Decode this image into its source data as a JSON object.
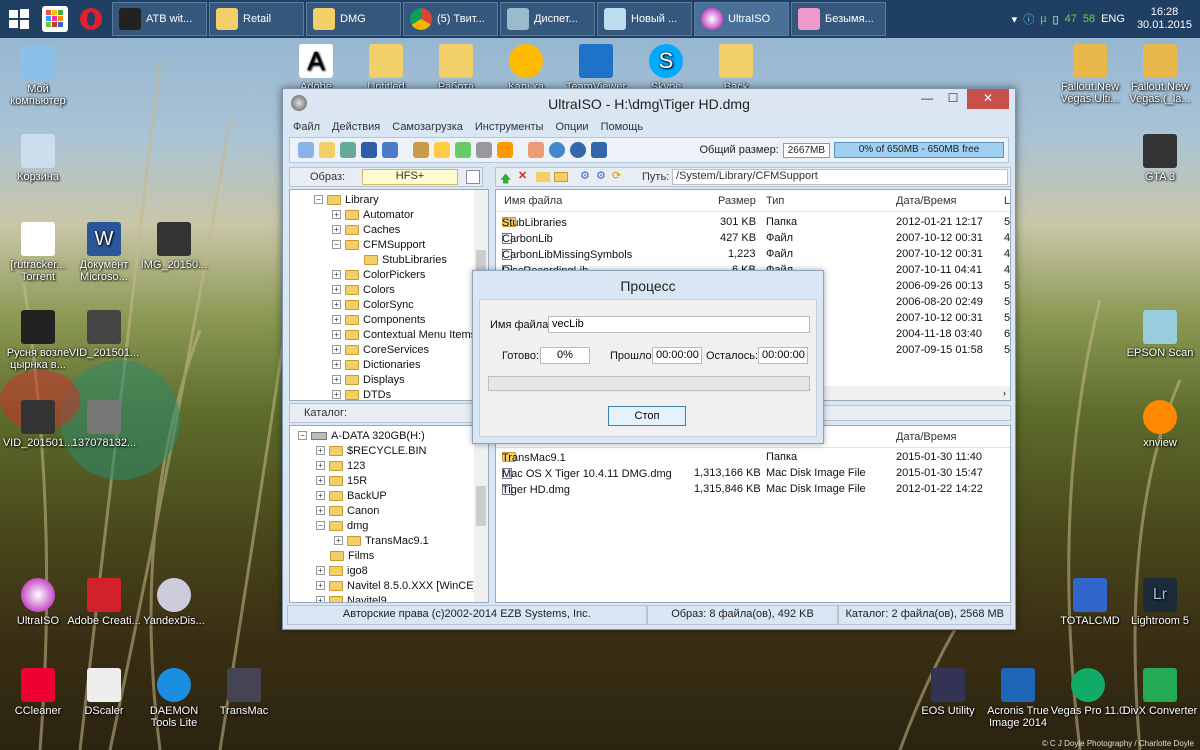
{
  "taskbar": {
    "tasks": [
      "ATB wit...",
      "Retail",
      "DMG",
      "(5) Твит...",
      "Диспет...",
      "Новый ...",
      "UltraISO",
      "Безымя..."
    ],
    "tray": {
      "lang": "ENG",
      "n1": "47",
      "n2": "58",
      "time": "16:28",
      "date": "30.01.2015"
    }
  },
  "desktop": {
    "left": [
      "Мой компьютер",
      "Корзина",
      "[rutracker... Torrent",
      "Документ Microso...",
      "IMG_20150...",
      "Русня возле цырнка в...",
      "VID_201501...",
      "VID_201501...",
      "137078132...",
      "UltraISO",
      "Adobe Creati...",
      "YandexDis...",
      "CCleaner",
      "DScaler",
      "DAEMON Tools Lite",
      "TransMac"
    ],
    "right": [
      "Fallout.New Vegas.Ulti...",
      "Fallout.New Vegas.(_la...",
      "GTA 3",
      "EPSON Scan",
      "xnview",
      "TOTALCMD",
      "Lightroom 5",
      "EOS Utility",
      "Acronis True Image 2014",
      "Vegas Pro 11.0",
      "DivX Converter"
    ],
    "top": [
      "Adobe",
      "Untitled",
      "Работа",
      "Калька",
      "TeamViewer",
      "Skype",
      "Back"
    ],
    "credit": "© C J Doyle Photography / Charlotte Doyle"
  },
  "window": {
    "title": "UltraISO - H:\\dmg\\Tiger HD.dmg",
    "menu": [
      "Файл",
      "Действия",
      "Самозагрузка",
      "Инструменты",
      "Опции",
      "Помощь"
    ],
    "size_label": "Общий размер:",
    "size_value": "2667MB",
    "size_bar": "0% of 650MB - 650MB free",
    "size_fill": 0,
    "image_label": "Образ:",
    "image_type": "HFS+",
    "path_label": "Путь:",
    "path_value": "/System/Library/CFMSupport",
    "catalog_label": "Каталог:",
    "iso_tree": [
      "Library",
      "Automator",
      "Caches",
      "CFMSupport",
      "StubLibraries",
      "ColorPickers",
      "Colors",
      "ColorSync",
      "Components",
      "Contextual Menu Items",
      "CoreServices",
      "Dictionaries",
      "Displays",
      "DTDs"
    ],
    "iso_columns": [
      "Имя файла",
      "Размер",
      "Тип",
      "Дата/Время",
      "L"
    ],
    "iso_files": [
      {
        "name": "StubLibraries",
        "size": "301 KB",
        "type": "Папка",
        "date": "2012-01-21 12:17",
        "l": "5"
      },
      {
        "name": "CarbonLib",
        "size": "427 KB",
        "type": "Файл",
        "date": "2007-10-12 00:31",
        "l": "4"
      },
      {
        "name": "CarbonLibMissingSymbols",
        "size": "1,223",
        "type": "Файл",
        "date": "2007-10-12 00:31",
        "l": "4"
      },
      {
        "name": "DiscRecordingLib",
        "size": "6 KB",
        "type": "Файл",
        "date": "2007-10-11 04:41",
        "l": "4"
      },
      {
        "name": "",
        "size": "",
        "type": "",
        "date": "2006-09-26 00:13",
        "l": "5"
      },
      {
        "name": "",
        "size": "",
        "type": "",
        "date": "2006-08-20 02:49",
        "l": "5"
      },
      {
        "name": "",
        "size": "",
        "type": "",
        "date": "2007-10-12 00:31",
        "l": "5"
      },
      {
        "name": "",
        "size": "",
        "type": "",
        "date": "2004-11-18 03:40",
        "l": "6"
      },
      {
        "name": "",
        "size": "",
        "type": "",
        "date": "2007-09-15 01:58",
        "l": "5"
      }
    ],
    "local_tree": [
      "A-DATA 320GB(H:)",
      "$RECYCLE.BIN",
      "123",
      "15R",
      "BackUP",
      "Canon",
      "dmg",
      "TransMac9.1",
      "Films",
      "igo8",
      "Navitel 8.5.0.XXX [WinCE]",
      "Navitel9"
    ],
    "local_columns": [
      "Дата/Время"
    ],
    "local_files": [
      {
        "name": "TransMac9.1",
        "size": "",
        "type": "Папка",
        "date": "2015-01-30 11:40"
      },
      {
        "name": "Mac OS X Tiger 10.4.11 DMG.dmg",
        "size": "1,313,166 KB",
        "type": "Mac Disk Image File",
        "date": "2015-01-30 15:47"
      },
      {
        "name": "Tiger HD.dmg",
        "size": "1,315,846 KB",
        "type": "Mac Disk Image File",
        "date": "2012-01-22 14:22"
      }
    ],
    "status": [
      "Авторские права (c)2002-2014 EZB Systems, Inc.",
      "Образ: 8 файла(ов), 492 KB",
      "Каталог: 2 файла(ов), 2568 MB"
    ]
  },
  "dialog": {
    "title": "Процесс",
    "file_label": "Имя файла:",
    "file_value": "vecLib",
    "done_label": "Готово:",
    "done_value": "0%",
    "elapsed_label": "Прошло:",
    "elapsed_value": "00:00:00",
    "remaining_label": "Осталось:",
    "remaining_value": "00:00:00",
    "progress": 0,
    "stop": "Стоп"
  }
}
